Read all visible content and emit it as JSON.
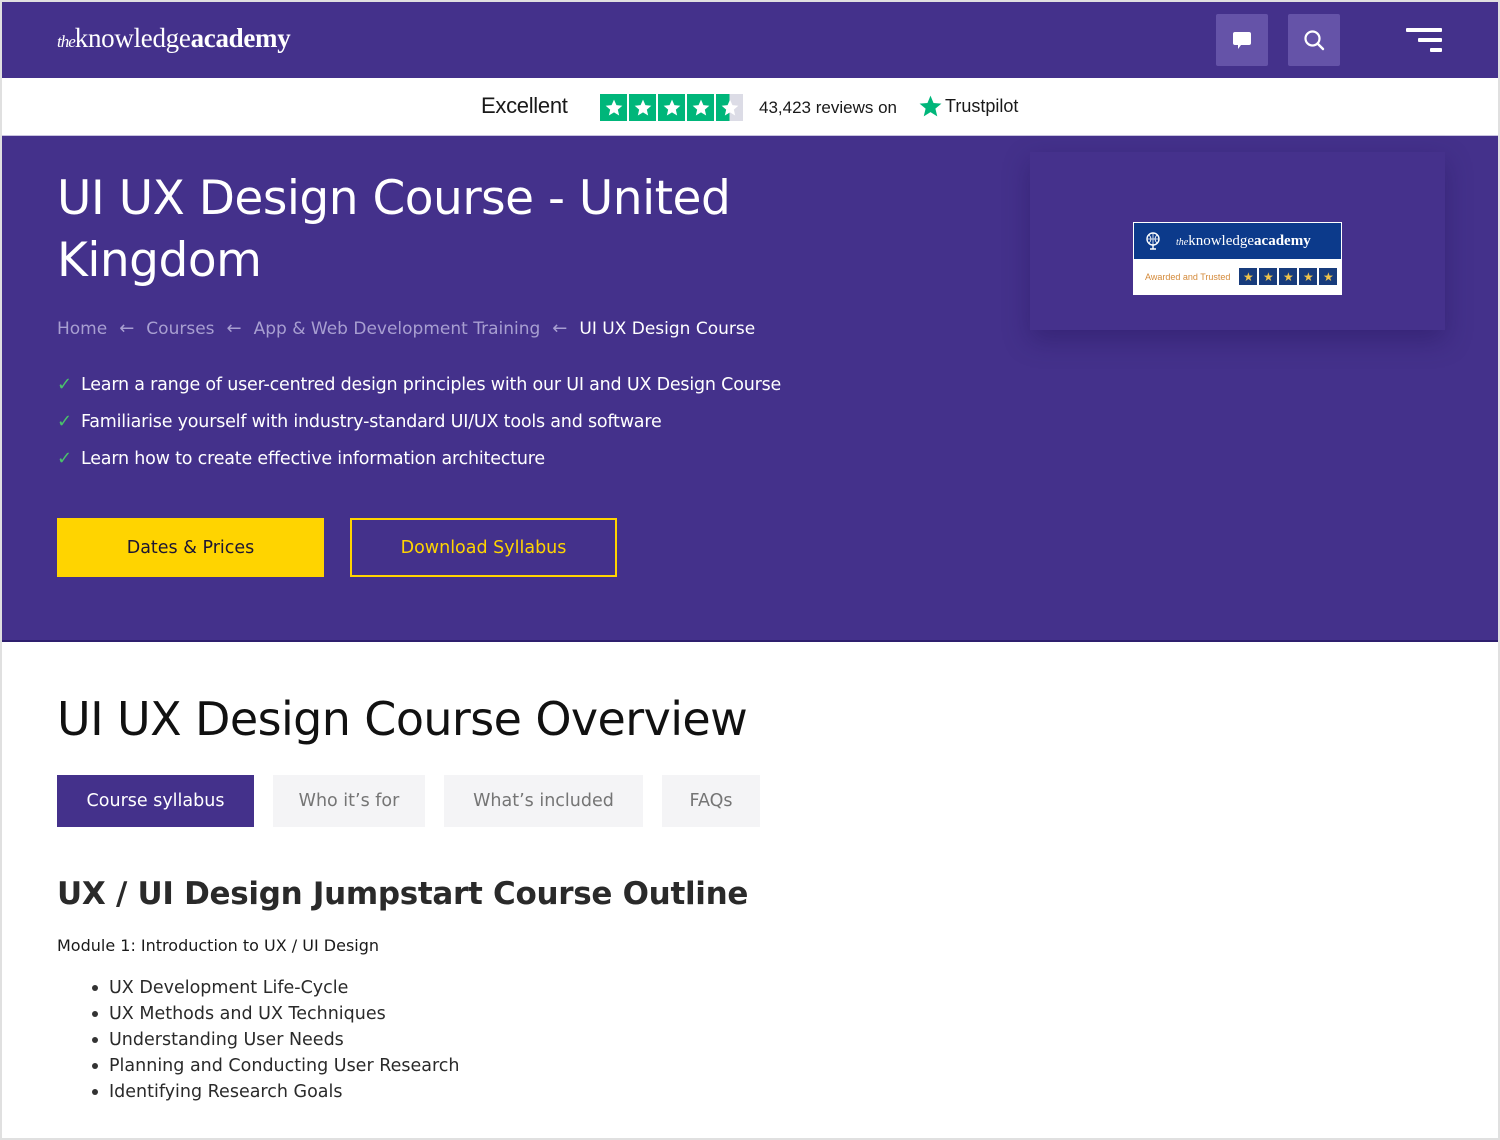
{
  "header": {
    "logo": {
      "the": "the",
      "knowledge": "knowledge",
      "academy": "academy"
    },
    "icons": {
      "chat": "chat-icon",
      "search": "search-icon",
      "menu": "menu-icon"
    }
  },
  "trustpilot": {
    "rating_label": "Excellent",
    "stars": 4.5,
    "reviews_text": "43,423 reviews on",
    "brand": "Trustpilot",
    "colors": {
      "star_bg": "#00b67a"
    }
  },
  "hero": {
    "title": "UI UX Design Course - United Kingdom",
    "breadcrumb": [
      {
        "label": "Home"
      },
      {
        "label": "Courses"
      },
      {
        "label": "App & Web Development Training"
      },
      {
        "label": "UI UX Design Course"
      }
    ],
    "features": [
      "Learn a range of user-centred design principles with our UI and UX Design Course",
      "Familiarise yourself with industry-standard UI/UX tools and software",
      "Learn how to create effective information architecture"
    ],
    "primary_button": "Dates & Prices",
    "secondary_button": "Download Syllabus",
    "badge": {
      "logo_the": "the",
      "logo_knowledge": "knowledge",
      "logo_academy": "academy",
      "tagline": "Awarded and Trusted",
      "stars": 5
    },
    "colors": {
      "background": "#44318b",
      "accent": "#ffd400",
      "check": "#4ac26b"
    }
  },
  "overview": {
    "title": "UI UX Design Course Overview",
    "tabs": [
      {
        "label": "Course syllabus",
        "active": true
      },
      {
        "label": "Who it’s for",
        "active": false
      },
      {
        "label": "What’s included",
        "active": false
      },
      {
        "label": "FAQs",
        "active": false
      }
    ],
    "outline_title": "UX / UI Design Jumpstart Course Outline",
    "module_title": "Module 1: Introduction to UX / UI Design",
    "module_items": [
      "UX Development Life-Cycle",
      "UX Methods and UX Techniques",
      "Understanding User Needs",
      "Planning and Conducting User Research",
      "Identifying Research Goals"
    ]
  }
}
